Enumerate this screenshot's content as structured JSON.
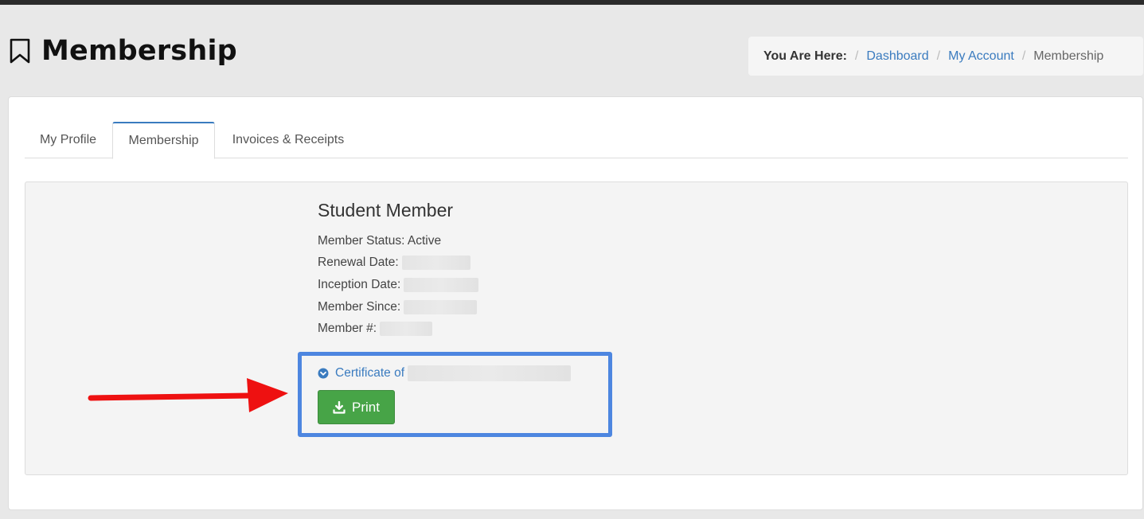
{
  "header": {
    "title": "Membership",
    "icon": "bookmark-icon"
  },
  "breadcrumb": {
    "lead": "You Are Here:",
    "items": [
      "Dashboard",
      "My Account",
      "Membership"
    ],
    "separator": "/"
  },
  "tabs": [
    {
      "label": "My Profile",
      "active": false
    },
    {
      "label": "Membership",
      "active": true
    },
    {
      "label": "Invoices & Receipts",
      "active": false
    }
  ],
  "membership": {
    "plan": "Student Member",
    "status": "Member Status: Active",
    "renewal_label": "Renewal Date:",
    "inception_label": "Inception Date:",
    "since_label": "Member Since:",
    "number_label": "Member #:",
    "certificate_label": "Certificate of",
    "print_label": "Print"
  },
  "colors": {
    "link": "#3a7bbf",
    "print_button": "#47a447",
    "highlight_box": "#4d86e0",
    "arrow": "#ee1111"
  }
}
